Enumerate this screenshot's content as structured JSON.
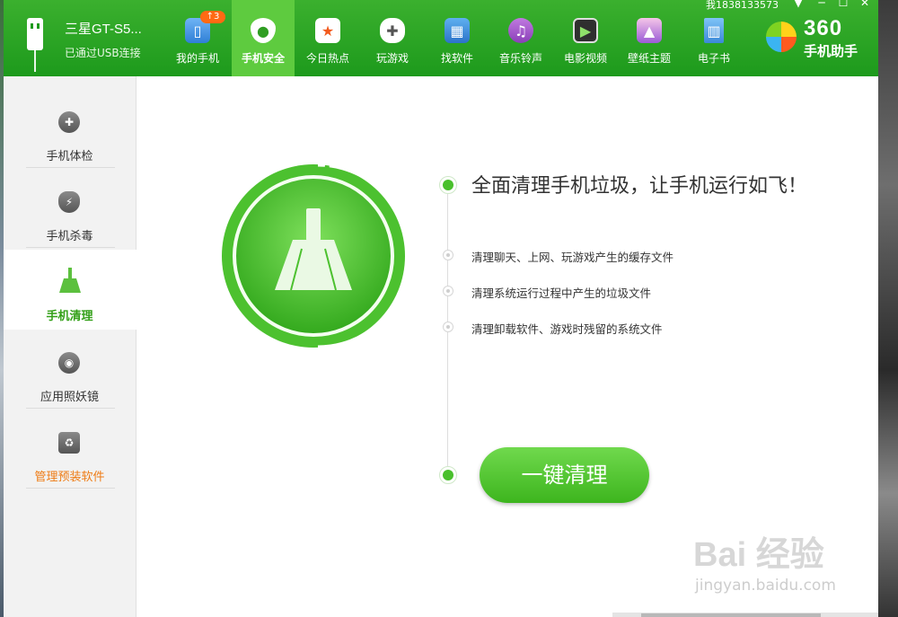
{
  "device": {
    "name": "三星GT-S5...",
    "status": "已通过USB连接"
  },
  "nav": [
    {
      "label": "我的手机",
      "icon": "phone-icon",
      "badge": "↑3"
    },
    {
      "label": "手机安全",
      "icon": "shield-icon",
      "active": true
    },
    {
      "label": "今日热点",
      "icon": "star-icon"
    },
    {
      "label": "玩游戏",
      "icon": "gamepad-icon"
    },
    {
      "label": "找软件",
      "icon": "app-store-icon"
    },
    {
      "label": "音乐铃声",
      "icon": "music-icon"
    },
    {
      "label": "电影视频",
      "icon": "film-icon"
    },
    {
      "label": "壁纸主题",
      "icon": "picture-icon"
    },
    {
      "label": "电子书",
      "icon": "book-icon"
    }
  ],
  "account": "我1838133573",
  "window_controls": [
    "▼",
    "─",
    "☐",
    "✕"
  ],
  "logo": {
    "number": "360",
    "name": "手机助手"
  },
  "sidebar": [
    {
      "label": "手机体检",
      "icon": "checkup-icon"
    },
    {
      "label": "手机杀毒",
      "icon": "antivirus-shield-icon"
    },
    {
      "label": "手机清理",
      "icon": "broom-icon",
      "active": true
    },
    {
      "label": "应用照妖镜",
      "icon": "eye-lens-icon"
    },
    {
      "label": "管理预装软件",
      "icon": "trash-recycle-icon",
      "highlight": true
    }
  ],
  "main": {
    "headline": "全面清理手机垃圾，让手机运行如飞！",
    "bullets": [
      "清理聊天、上网、玩游戏产生的缓存文件",
      "清理系统运行过程中产生的垃圾文件",
      "清理卸载软件、游戏时残留的系统文件"
    ],
    "clean_button": "一键清理"
  },
  "watermark": {
    "main": "Bai 经验",
    "sub": "jingyan.baidu.com"
  },
  "colors": {
    "brand_green": "#1d9a1c",
    "accent_green": "#49c02c",
    "orange": "#ee7b14"
  }
}
